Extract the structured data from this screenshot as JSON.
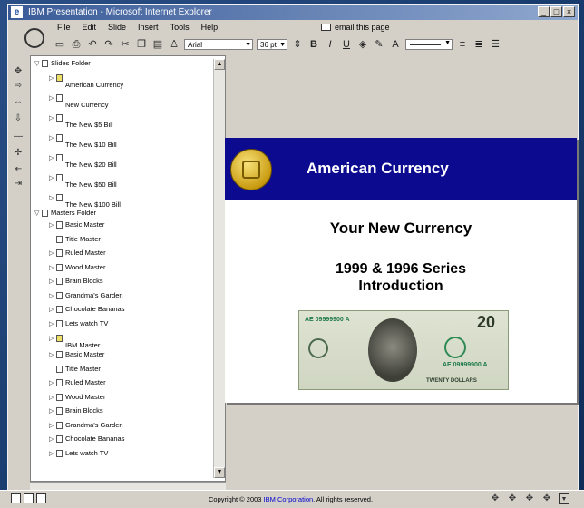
{
  "window": {
    "title": "IBM Presentation - Microsoft Internet Explorer",
    "controls": [
      "_",
      "□",
      "×"
    ]
  },
  "menu": [
    "File",
    "Edit",
    "Slide",
    "Insert",
    "Tools",
    "Help"
  ],
  "email_link": "email this page",
  "toolbar": {
    "font": "Arial",
    "font_size": "36 pt",
    "bold": "B",
    "italic": "I",
    "underline": "U"
  },
  "tree": {
    "slides_folder": "Slides Folder",
    "slides": [
      "American Currency",
      "New Currency",
      "The New $5 Bill",
      "The New $10 Bill",
      "The New $20 Bill",
      "The New $50 Bill",
      "The New $100 Bill"
    ],
    "masters_folder": "Masters Folder",
    "masters_a": [
      "Basic Master",
      "Title Master",
      "Ruled Master",
      "Wood Master",
      "Brain Blocks",
      "Grandma's Garden",
      "Chocolate Bananas",
      "Lets watch TV"
    ],
    "ibm_master": "IBM Master",
    "masters_b": [
      "Basic Master",
      "Title Master",
      "Ruled Master",
      "Wood Master",
      "Brain Blocks",
      "Grandma's Garden",
      "Chocolate Bananas",
      "Lets watch TV"
    ]
  },
  "slide": {
    "header": "American Currency",
    "subtitle": "Your New Currency",
    "series_line1": "1999 & 1996 Series",
    "series_line2": "Introduction",
    "bill": {
      "serial": "AE 09999900 A",
      "serial2": "AE 09999900 A",
      "denomination": "20",
      "footer": "TWENTY DOLLARS"
    }
  },
  "status": {
    "copyright_prefix": "Copyright © 2003 ",
    "copyright_link": "IBM Corporation",
    "copyright_suffix": ". All rights reserved."
  },
  "colors": {
    "slide_header": "#0c0a8e",
    "desktop": "#1c3e73"
  }
}
